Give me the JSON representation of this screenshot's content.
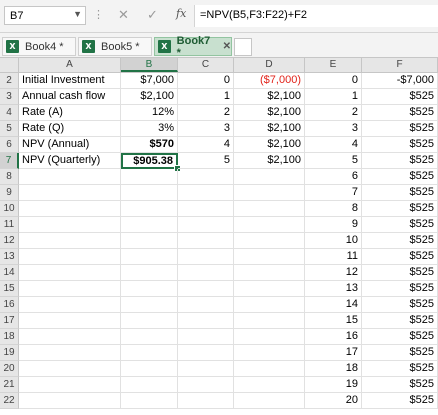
{
  "formula_bar": {
    "name_box": "B7",
    "formula": "=NPV(B5,F3:F22)+F2",
    "fx_label": "fx",
    "cancel_label": "✕",
    "enter_label": "✓"
  },
  "tabs": [
    {
      "label": "Book4 *",
      "active": false
    },
    {
      "label": "Book5 *",
      "active": false
    },
    {
      "label": "Book7 *",
      "active": true
    }
  ],
  "columns": [
    "A",
    "B",
    "C",
    "D",
    "E",
    "F"
  ],
  "selected": {
    "col": "B",
    "row": 7
  },
  "rows": [
    {
      "n": "2",
      "A": "Initial Investment",
      "B": "$7,000",
      "C": "0",
      "D": "($7,000)",
      "E": "0",
      "F": "-$7,000"
    },
    {
      "n": "3",
      "A": "Annual cash flow",
      "B": "$2,100",
      "C": "1",
      "D": "$2,100",
      "E": "1",
      "F": "$525"
    },
    {
      "n": "4",
      "A": "Rate (A)",
      "B": "12%",
      "C": "2",
      "D": "$2,100",
      "E": "2",
      "F": "$525"
    },
    {
      "n": "5",
      "A": "Rate (Q)",
      "B": "3%",
      "C": "3",
      "D": "$2,100",
      "E": "3",
      "F": "$525"
    },
    {
      "n": "6",
      "A": "NPV (Annual)",
      "B": "$570",
      "C": "4",
      "D": "$2,100",
      "E": "4",
      "F": "$525"
    },
    {
      "n": "7",
      "A": "NPV (Quarterly)",
      "B": "$905.38",
      "C": "5",
      "D": "$2,100",
      "E": "5",
      "F": "$525"
    },
    {
      "n": "8",
      "A": "",
      "B": "",
      "C": "",
      "D": "",
      "E": "6",
      "F": "$525"
    },
    {
      "n": "9",
      "A": "",
      "B": "",
      "C": "",
      "D": "",
      "E": "7",
      "F": "$525"
    },
    {
      "n": "10",
      "A": "",
      "B": "",
      "C": "",
      "D": "",
      "E": "8",
      "F": "$525"
    },
    {
      "n": "11",
      "A": "",
      "B": "",
      "C": "",
      "D": "",
      "E": "9",
      "F": "$525"
    },
    {
      "n": "12",
      "A": "",
      "B": "",
      "C": "",
      "D": "",
      "E": "10",
      "F": "$525"
    },
    {
      "n": "13",
      "A": "",
      "B": "",
      "C": "",
      "D": "",
      "E": "11",
      "F": "$525"
    },
    {
      "n": "14",
      "A": "",
      "B": "",
      "C": "",
      "D": "",
      "E": "12",
      "F": "$525"
    },
    {
      "n": "15",
      "A": "",
      "B": "",
      "C": "",
      "D": "",
      "E": "13",
      "F": "$525"
    },
    {
      "n": "16",
      "A": "",
      "B": "",
      "C": "",
      "D": "",
      "E": "14",
      "F": "$525"
    },
    {
      "n": "17",
      "A": "",
      "B": "",
      "C": "",
      "D": "",
      "E": "15",
      "F": "$525"
    },
    {
      "n": "18",
      "A": "",
      "B": "",
      "C": "",
      "D": "",
      "E": "16",
      "F": "$525"
    },
    {
      "n": "19",
      "A": "",
      "B": "",
      "C": "",
      "D": "",
      "E": "17",
      "F": "$525"
    },
    {
      "n": "20",
      "A": "",
      "B": "",
      "C": "",
      "D": "",
      "E": "18",
      "F": "$525"
    },
    {
      "n": "21",
      "A": "",
      "B": "",
      "C": "",
      "D": "",
      "E": "19",
      "F": "$525"
    },
    {
      "n": "22",
      "A": "",
      "B": "",
      "C": "",
      "D": "",
      "E": "20",
      "F": "$525"
    }
  ],
  "colors": {
    "accent": "#217346",
    "negative": "#e2231a"
  }
}
